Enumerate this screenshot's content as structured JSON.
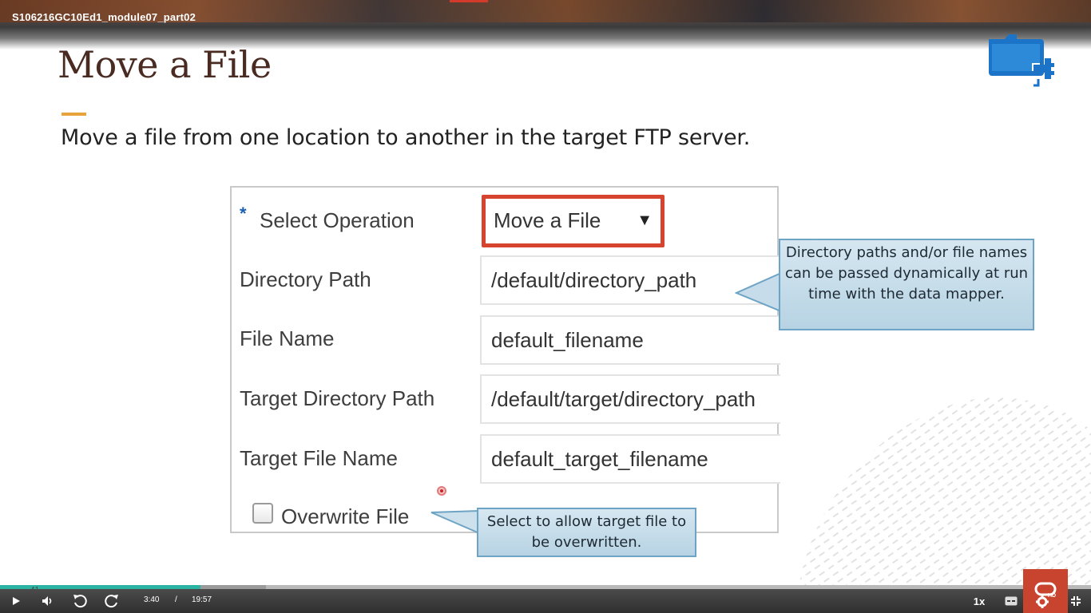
{
  "video": {
    "title": "S106216GC10Ed1_module07_part02"
  },
  "slide": {
    "title": "Move a File",
    "subtitle": "Move a file from one location to another in the target FTP server.",
    "accent_color": "#e8a43a",
    "icon": "ftp-adapter-icon"
  },
  "form": {
    "required_marker": "*",
    "select_operation": {
      "label": "Select Operation",
      "value": "Move a File",
      "caret": "▼"
    },
    "directory_path": {
      "label": "Directory Path",
      "value": "/default/directory_path"
    },
    "file_name": {
      "label": "File Name",
      "value": "default_filename"
    },
    "target_directory_path": {
      "label": "Target Directory Path",
      "value": "/default/target/directory_path"
    },
    "target_file_name": {
      "label": "Target File Name",
      "value": "default_target_filename"
    },
    "overwrite_file": {
      "label": "Overwrite File",
      "checked": false
    },
    "highlight_color": "#d6432f"
  },
  "callouts": {
    "dynamic_paths": "Directory paths and/or file names can be passed dynamically at run time with the data mapper.",
    "overwrite": "Select to allow target file to be overwritten."
  },
  "player": {
    "slide_number": "41",
    "current_time": "3:40",
    "separator": "/",
    "duration": "19:57",
    "progress_fraction": 0.184,
    "buffered_fraction": 0.244,
    "speed": "1x",
    "quality_badge": "HD",
    "played_color": "#2bb3a3",
    "brand_color": "#c9442e"
  }
}
